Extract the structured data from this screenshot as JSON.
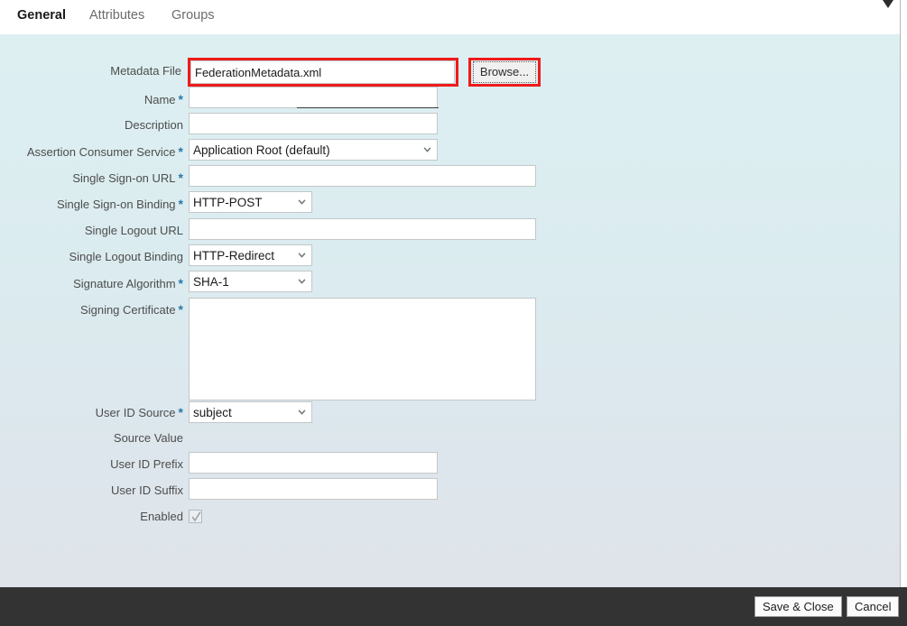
{
  "tabs": [
    {
      "label": "General",
      "active": true
    },
    {
      "label": "Attributes",
      "active": false
    },
    {
      "label": "Groups",
      "active": false
    }
  ],
  "form": {
    "metadata_file": {
      "label": "Metadata File",
      "value": "FederationMetadata.xml",
      "required": false,
      "highlighted": true
    },
    "browse_button": {
      "label": "Browse...",
      "highlighted": true
    },
    "name": {
      "label": "Name",
      "value": "",
      "required": true
    },
    "description": {
      "label": "Description",
      "value": "",
      "required": false
    },
    "assertion_consumer_service": {
      "label": "Assertion Consumer Service",
      "value": "Application Root (default)",
      "required": true,
      "options": [
        "Application Root (default)"
      ]
    },
    "single_signon_url": {
      "label": "Single Sign-on URL",
      "value": "",
      "required": true
    },
    "single_signon_binding": {
      "label": "Single Sign-on Binding",
      "value": "HTTP-POST",
      "required": true,
      "options": [
        "HTTP-POST"
      ]
    },
    "single_logout_url": {
      "label": "Single Logout URL",
      "value": "",
      "required": false
    },
    "single_logout_binding": {
      "label": "Single Logout Binding",
      "value": "HTTP-Redirect",
      "required": false,
      "options": [
        "HTTP-Redirect"
      ]
    },
    "signature_algorithm": {
      "label": "Signature Algorithm",
      "value": "SHA-1",
      "required": true,
      "options": [
        "SHA-1"
      ]
    },
    "signing_certificate": {
      "label": "Signing Certificate",
      "value": "",
      "required": true
    },
    "user_id_source": {
      "label": "User ID Source",
      "value": "subject",
      "required": true,
      "options": [
        "subject"
      ]
    },
    "source_value": {
      "label": "Source Value",
      "value": "",
      "required": false
    },
    "user_id_prefix": {
      "label": "User ID Prefix",
      "value": "",
      "required": false
    },
    "user_id_suffix": {
      "label": "User ID Suffix",
      "value": "",
      "required": false
    },
    "enabled": {
      "label": "Enabled",
      "checked": true
    }
  },
  "footer": {
    "save_label": "Save & Close",
    "cancel_label": "Cancel"
  },
  "colors": {
    "highlight": "#ee1b1b",
    "required_asterisk": "#2a78a8",
    "footer_background": "#333333",
    "panel_top": "#ddeff1",
    "panel_bottom": "#dfe4ea"
  }
}
